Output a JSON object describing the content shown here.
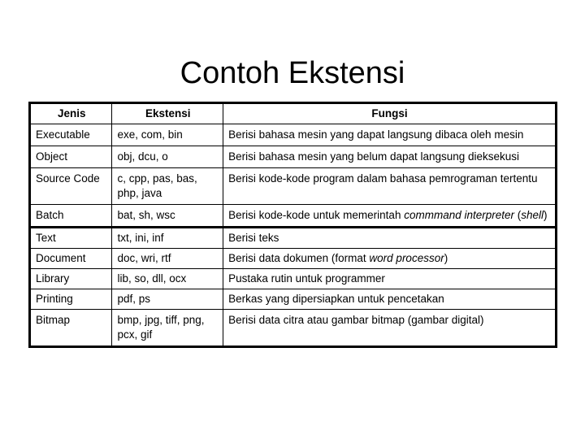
{
  "slide": {
    "title": "Contoh Ekstensi"
  },
  "table": {
    "headers": {
      "jenis": "Jenis",
      "ekstensi": "Ekstensi",
      "fungsi": "Fungsi"
    },
    "rows": [
      {
        "jenis": "Executable",
        "ekstensi": "exe, com, bin",
        "fungsi": "Berisi bahasa mesin yang dapat langsung dibaca oleh mesin"
      },
      {
        "jenis": "Object",
        "ekstensi": "obj, dcu, o",
        "fungsi": "Berisi bahasa mesin yang belum dapat langsung dieksekusi"
      },
      {
        "jenis": "Source Code",
        "ekstensi": "c, cpp, pas, bas, php, java",
        "fungsi": "Berisi kode-kode program dalam bahasa pemrograman tertentu"
      },
      {
        "jenis": "Batch",
        "ekstensi": "bat, sh, wsc",
        "fungsi_parts": {
          "lead": "Berisi kode-kode untuk memerintah ",
          "italic1": "commmand interpreter",
          "mid": " (",
          "italic2": "shell",
          "tail": ")"
        }
      },
      {
        "jenis": "Text",
        "ekstensi": "txt, ini, inf",
        "fungsi": "Berisi teks"
      },
      {
        "jenis": "Document",
        "ekstensi": "doc, wri, rtf",
        "fungsi_parts": {
          "lead": "Berisi data dokumen (format ",
          "italic1": "word processor",
          "tail": ")"
        }
      },
      {
        "jenis": "Library",
        "ekstensi": "lib, so, dll, ocx",
        "fungsi": "Pustaka rutin untuk programmer"
      },
      {
        "jenis": "Printing",
        "ekstensi": "pdf, ps",
        "fungsi": "Berkas yang dipersiapkan untuk pencetakan"
      },
      {
        "jenis": "Bitmap",
        "ekstensi": "bmp, jpg, tiff, png, pcx, gif",
        "fungsi": "Berisi data citra atau gambar bitmap (gambar digital)"
      }
    ]
  }
}
